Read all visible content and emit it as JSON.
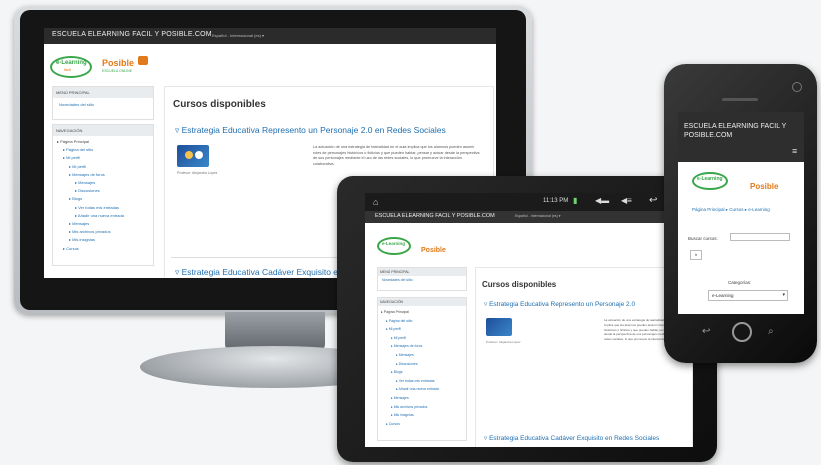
{
  "site": {
    "title": "ESCUELA ELEARNING FACIL Y POSIBLE.COM",
    "lang_menu": "Español - Internacional (es) ▾",
    "logo_left": "e-Learning",
    "logo_left_sub": "fácil",
    "logo_right": "Posible",
    "logo_right_sub": "ESCUELA ONLINE"
  },
  "blocks": {
    "main_menu_title": "MENÚ PRINCIPAL",
    "main_menu_item": "Novedades del sitio",
    "nav_title": "NAVEGACIÓN",
    "nav_items": [
      {
        "label": "Página Principal",
        "depth": 0
      },
      {
        "label": "Página del sitio",
        "depth": 1
      },
      {
        "label": "Mi perfil",
        "depth": 1
      },
      {
        "label": "Mi perfil",
        "depth": 2
      },
      {
        "label": "Mensajes de foros",
        "depth": 2
      },
      {
        "label": "Mensajes",
        "depth": 3
      },
      {
        "label": "Discusiones",
        "depth": 3
      },
      {
        "label": "Blogs",
        "depth": 2
      },
      {
        "label": "Ver todas mis entradas",
        "depth": 3
      },
      {
        "label": "Añadir una nueva entrada",
        "depth": 3
      },
      {
        "label": "Mensajes",
        "depth": 2
      },
      {
        "label": "Mis archivos privados",
        "depth": 2
      },
      {
        "label": "Mis insignias",
        "depth": 2
      },
      {
        "label": "Cursos",
        "depth": 1
      }
    ]
  },
  "content": {
    "heading": "Cursos disponibles",
    "course1_title": "Estrategia Educativa Represento un Personaje 2.0 en Redes Sociales",
    "course1_teacher": "Profesor: Alejandra López",
    "course1_desc": "La actuación de una estrategia de teatralidad en el aula implica que los alumnos pueden asumir roles de personajes históricos o ficticios y que pueden hablar, pensar y actuar desde la perspectiva de sus personajes mediante el uso de las redes sociales, lo que promueve la interacción colaborativa.",
    "course2_title": "Estrategia Educativa Cadáver Exquisito en Redes Sociales"
  },
  "tablet": {
    "status_time": "11:13 PM",
    "course1_title": "Estrategia Educativa Represento un Personaje 2.0",
    "course2_title": "Estrategia Educativa Cadáver Exquisito en Redes Sociales"
  },
  "phone": {
    "title": "ESCUELA ELEARNING FACIL Y POSIBLE.COM",
    "breadcrumb": "Página Principal  ▸  Cursos  ▸  e-Learning",
    "search_label": "Buscar cursos:",
    "go_label": "Ir",
    "categories_label": "Categorías:",
    "categories_value": "e-Learning",
    "menu_icon": "≡"
  },
  "colors": {
    "accent_link": "#1f6fb0",
    "topbar": "#2b2b2b",
    "logo_green": "#3aa64a",
    "logo_orange": "#e07a1a"
  }
}
